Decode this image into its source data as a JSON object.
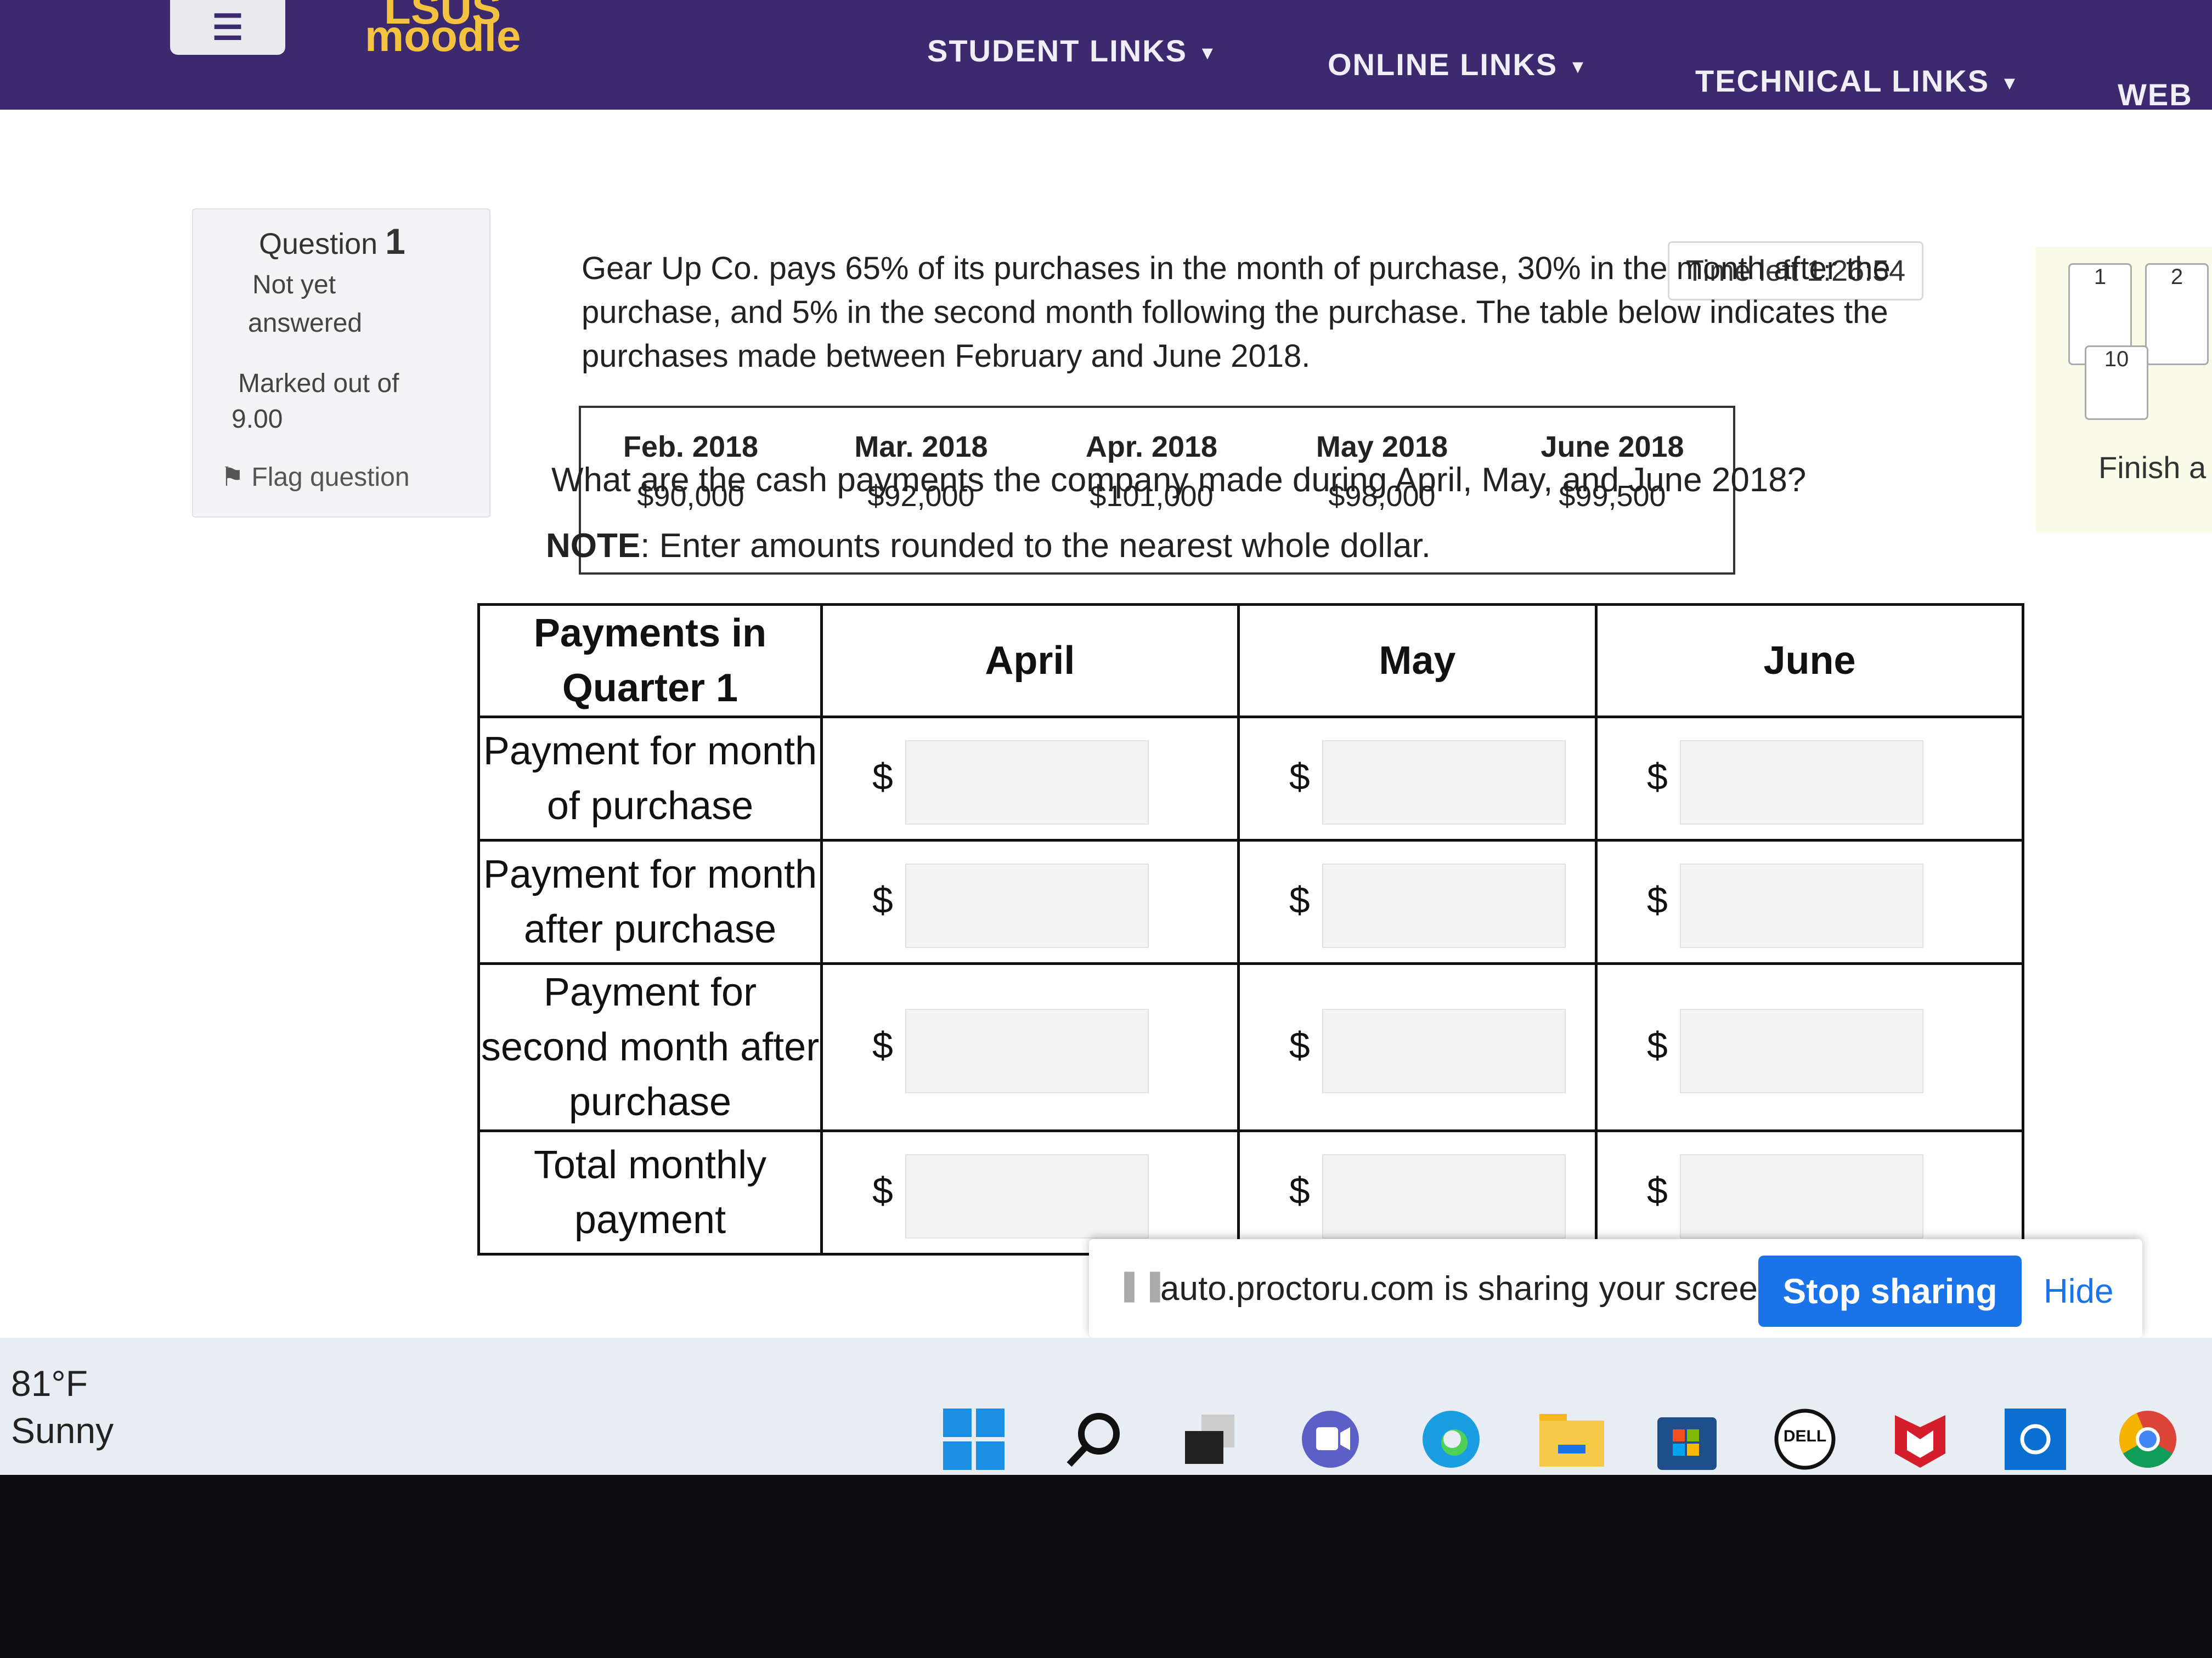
{
  "header": {
    "menu_icon": "hamburger-icon",
    "brand_sub": "LSUS",
    "brand": "moodle",
    "nav": [
      "STUDENT LINKS",
      "ONLINE LINKS",
      "TECHNICAL LINKS",
      "WEB L"
    ]
  },
  "question_info": {
    "question_label": "Question",
    "question_number": "1",
    "status_line1": "Not yet",
    "status_line2": "answered",
    "marked_line1": "Marked out of",
    "marked_line2": "9.00",
    "flag_label": "Flag question"
  },
  "timer": "Time left 1:26:54",
  "question": {
    "text": "Gear Up Co. pays 65% of its purchases in the month of purchase, 30% in the month after the purchase, and 5% in the second month following the purchase. The table below indicates the purchases made between February and June 2018.",
    "purchases": {
      "months": [
        "Feb. 2018",
        "Mar. 2018",
        "Apr. 2018",
        "May 2018",
        "June 2018"
      ],
      "amounts": [
        "$90,000",
        "$92,000",
        "$101,000",
        "$98,000",
        "$99,500"
      ]
    },
    "prompt": "What are the cash payments the company made during April, May, and June 2018?",
    "note_label": "NOTE",
    "note_text": ": Enter amounts rounded to the nearest whole dollar."
  },
  "answer_table": {
    "header_row_label": "Payments in Quarter 1",
    "columns": [
      "April",
      "May",
      "June"
    ],
    "rows": [
      "Payment for month of purchase",
      "Payment for month after purchase",
      "Payment for second month after purchase",
      "Total monthly payment"
    ],
    "currency": "$"
  },
  "quiz_nav": {
    "buttons": [
      "1",
      "2",
      "10"
    ],
    "finish": "Finish a"
  },
  "share_bar": {
    "message": "auto.proctoru.com is sharing your screen.",
    "stop": "Stop sharing",
    "hide": "Hide"
  },
  "taskbar": {
    "temperature": "81°F",
    "condition": "Sunny",
    "icons": [
      "windows-start-icon",
      "search-icon",
      "task-view-icon",
      "teams-icon",
      "edge-icon",
      "file-explorer-icon",
      "store-icon",
      "dell-icon",
      "mcafee-icon",
      "cortana-icon",
      "chrome-icon"
    ],
    "dell_text": "DELL"
  }
}
